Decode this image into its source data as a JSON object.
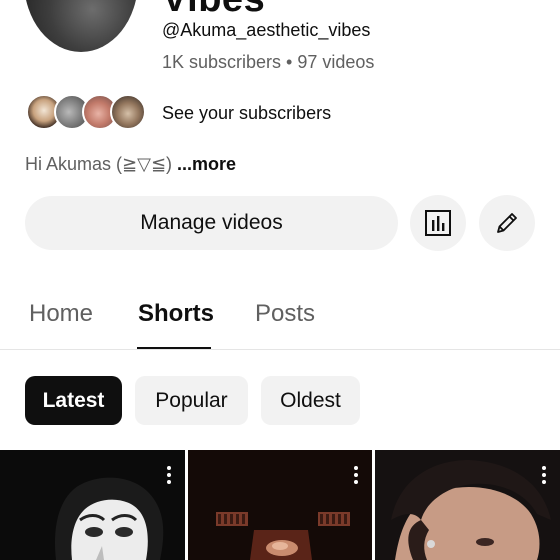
{
  "channel": {
    "title_cut": "Vibes",
    "handle": "@Akuma_aesthetic_vibes",
    "stats": "1K subscribers • 97 videos",
    "see_subscribers": "See your subscribers",
    "description": "Hi Akumas  (≧▽≦)",
    "more": "...more"
  },
  "actions": {
    "manage_videos": "Manage videos"
  },
  "tabs": [
    {
      "label": "Home"
    },
    {
      "label": "Shorts",
      "selected": true
    },
    {
      "label": "Posts"
    }
  ],
  "chips": [
    {
      "label": "Latest",
      "selected": true
    },
    {
      "label": "Popular"
    },
    {
      "label": "Oldest"
    }
  ],
  "icons": [
    "analytics-icon",
    "pencil-edit-icon",
    "more-vert-icon"
  ],
  "colors": {
    "text_primary": "#0f0f0f",
    "text_secondary": "#606060",
    "chip_bg": "#f2f2f2",
    "chip_selected_bg": "#0f0f0f"
  }
}
